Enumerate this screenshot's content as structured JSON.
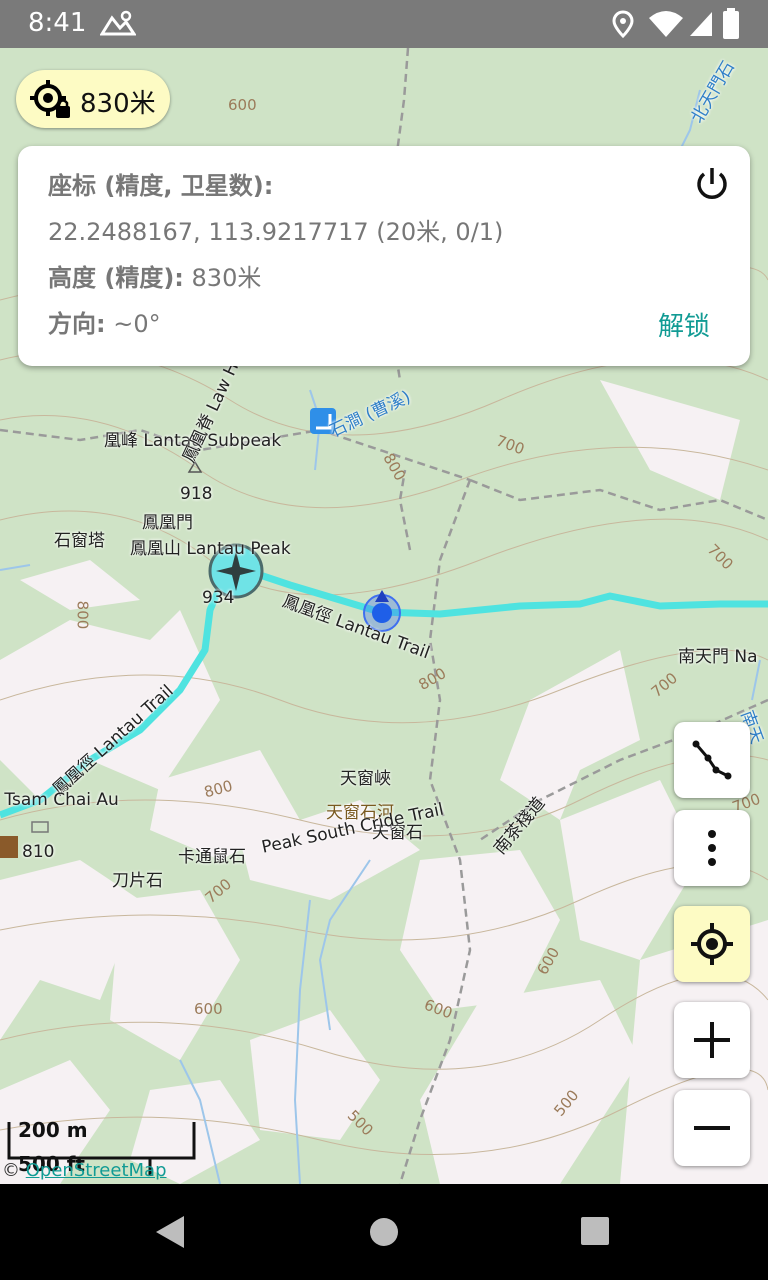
{
  "status_bar": {
    "time": "8:41"
  },
  "altitude_chip": {
    "value": "830米"
  },
  "info_card": {
    "coord_label": "座标 (精度, 卫星数):",
    "coord_value": "22.2488167, 113.9217717 (20米, 0/1)",
    "altitude_label": "高度 (精度):",
    "altitude_value": "830米",
    "direction_label": "方向:",
    "direction_value": "~0°",
    "unlock_label": "解锁"
  },
  "map": {
    "labels": {
      "phoenix_peak_sub": "凰峰 Lantau Subpeak",
      "height_918": "918",
      "shichuangta": "石窗塔",
      "fenghuangmen": "鳳凰門",
      "lantau_peak": "鳳凰山 Lantau Peak",
      "height_934": "934",
      "lantau_trail_east": "鳳凰徑 Lantau Trail",
      "lantau_trail_west": "鳳凰徑 Lantau Trail",
      "nantianmen": "南天門 Na",
      "tianchuangxia": "天窗峽",
      "tianchuang_river": "天窗石河",
      "tianchuangshi": "天窗石",
      "tsam_chai_au": "I Tsam Chai Au",
      "height_810": "810",
      "katong_shu": "卡通鼠石",
      "daopianshi": "刀片石",
      "south_ridge": "Peak South Cride Trail",
      "nancha_road": "南茶棧道",
      "stream": "石澗 (曹溪)",
      "north_stream": "北天門石",
      "law_path": "鳳凰脊 Law H",
      "north_label": "北",
      "nantian_top": "南天"
    },
    "contours": [
      "600",
      "700",
      "800",
      "700",
      "800",
      "800",
      "700",
      "800",
      "700",
      "700",
      "600",
      "600",
      "600",
      "500",
      "500"
    ],
    "trail_color": "#4fe3e0",
    "location_color": "#1f5fe8"
  },
  "scale_bar": {
    "metric": "200 m",
    "imperial": "500 ft"
  },
  "attribution": {
    "prefix": "©",
    "link": "OpenStreetMap"
  },
  "controls": [
    "track-icon",
    "more-icon",
    "my-location-icon",
    "zoom-in-icon",
    "zoom-out-icon"
  ]
}
